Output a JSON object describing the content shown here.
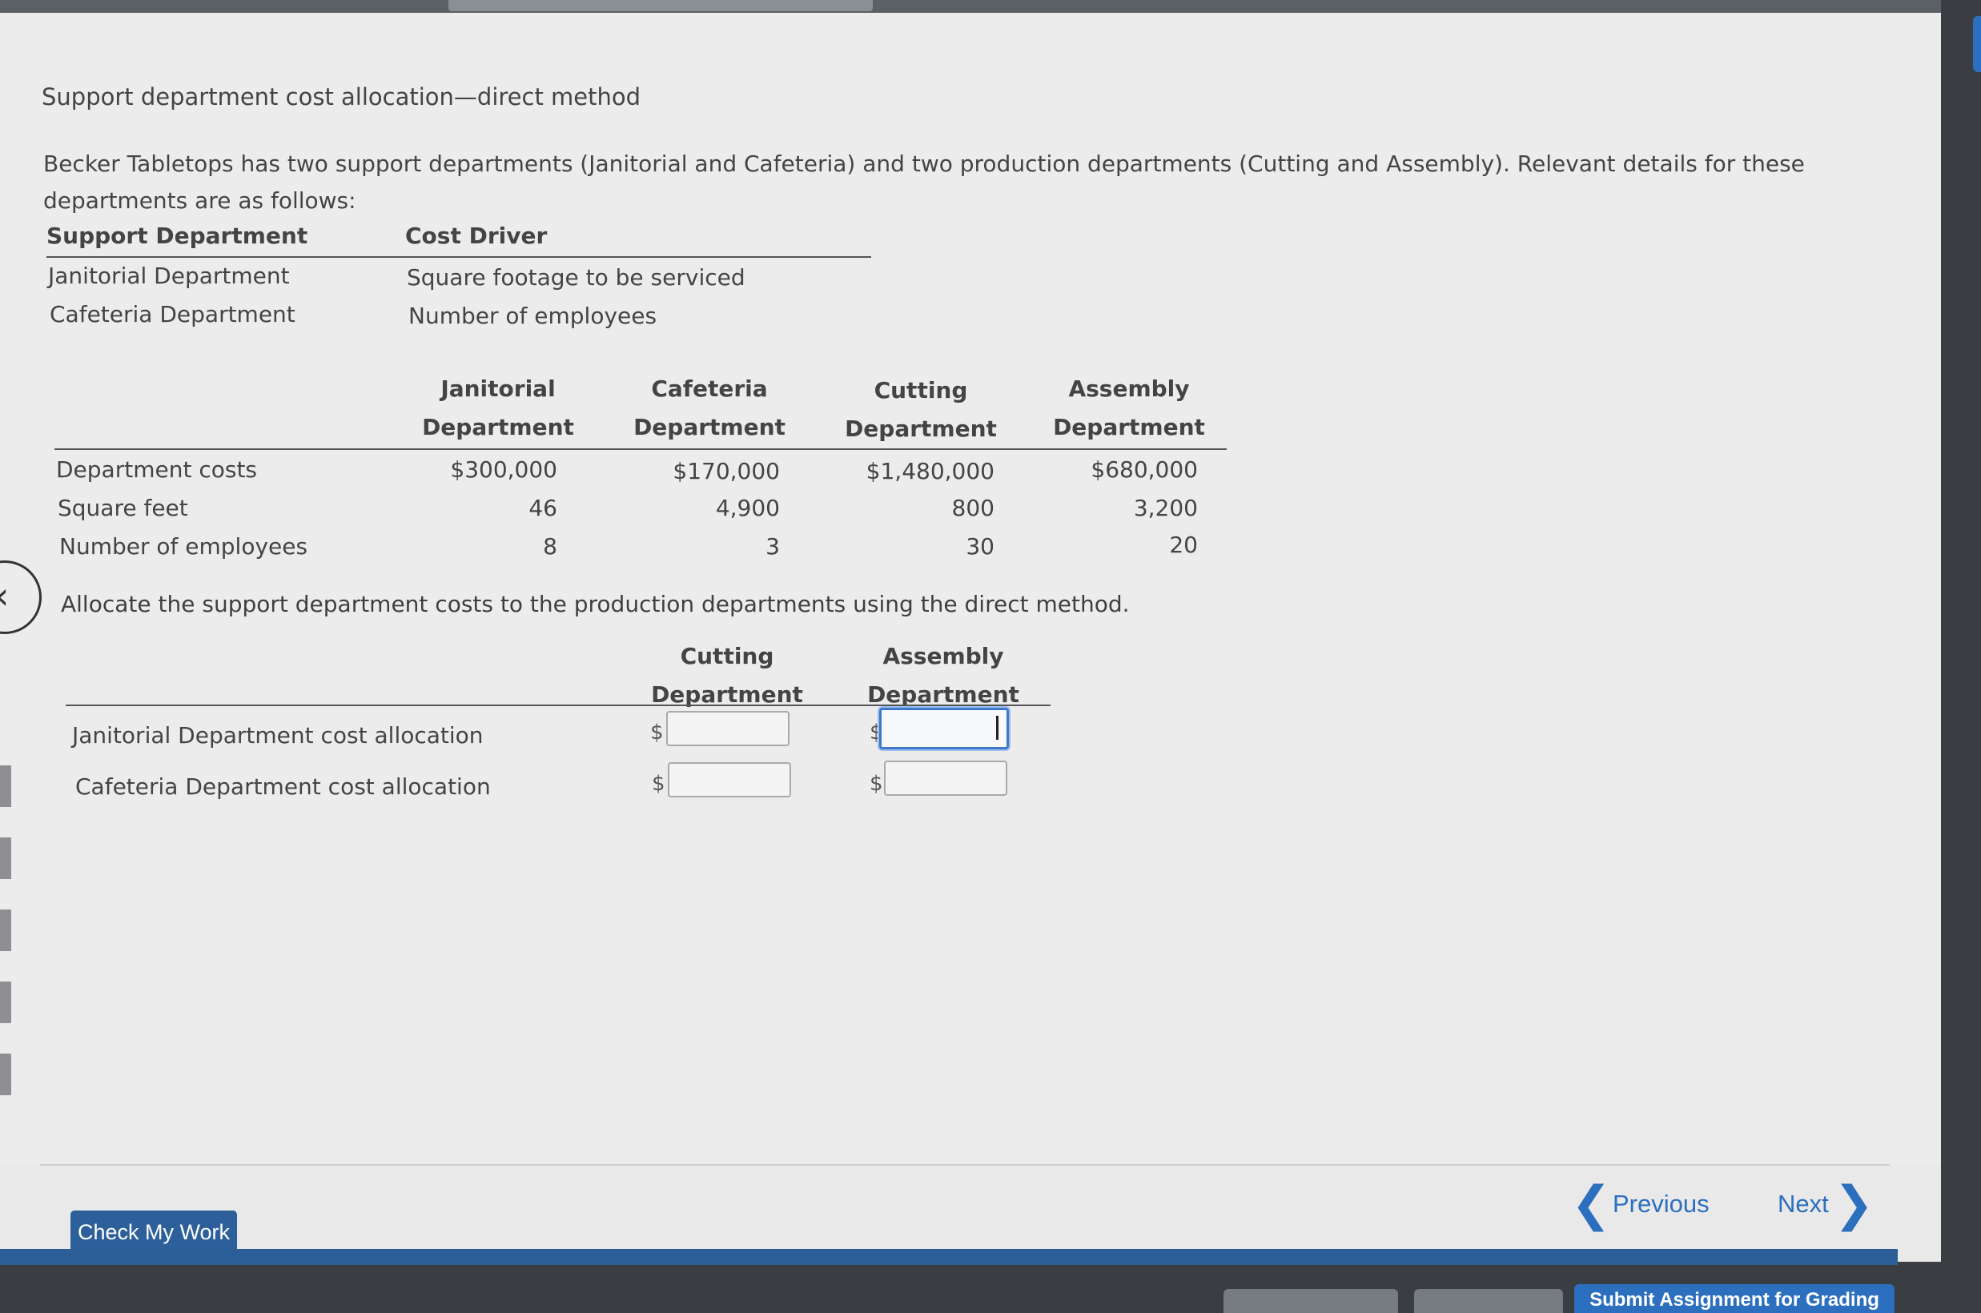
{
  "title": "Support department cost allocation—direct method",
  "intro": "Becker Tabletops has two support departments (Janitorial and Cafeteria) and two production departments (Cutting and Assembly). Relevant details for these departments are as follows:",
  "driver_table": {
    "headers": [
      "Support Department",
      "Cost Driver"
    ],
    "rows": [
      [
        "Janitorial Department",
        "Square footage to be serviced"
      ],
      [
        "Cafeteria Department",
        "Number of employees"
      ]
    ]
  },
  "details_table": {
    "columns": [
      {
        "line1": "Janitorial",
        "line2": "Department"
      },
      {
        "line1": "Cafeteria",
        "line2": "Department"
      },
      {
        "line1": "Cutting",
        "line2": "Department"
      },
      {
        "line1": "Assembly",
        "line2": "Department"
      }
    ],
    "rows": [
      {
        "label": "Department costs",
        "values": [
          "$300,000",
          "$170,000",
          "$1,480,000",
          "$680,000"
        ]
      },
      {
        "label": "Square feet",
        "values": [
          "46",
          "4,900",
          "800",
          "3,200"
        ]
      },
      {
        "label": "Number of employees",
        "values": [
          "8",
          "3",
          "30",
          "20"
        ]
      }
    ]
  },
  "instruction": "Allocate the support department costs to the production departments using the direct method.",
  "answer_table": {
    "columns": [
      {
        "line1": "Cutting",
        "line2": "Department"
      },
      {
        "line1": "Assembly",
        "line2": "Department"
      }
    ],
    "rows": [
      {
        "label": "Janitorial Department cost allocation",
        "prefix": "$"
      },
      {
        "label": "Cafeteria Department cost allocation",
        "prefix": "$"
      }
    ]
  },
  "footer": {
    "check_label": "Check My Work",
    "previous_label": "Previous",
    "next_label": "Next",
    "submit_label": "Submit Assignment for Grading"
  },
  "colors": {
    "accent": "#2d6fbf",
    "button": "#2d5f9a"
  }
}
